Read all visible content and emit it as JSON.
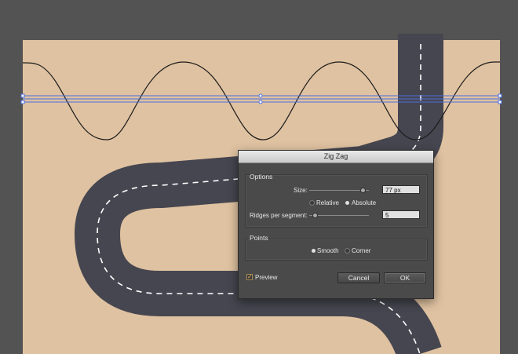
{
  "colors": {
    "workspace": "#535353",
    "artboard": "#dfc2a1",
    "road": "#464650",
    "road_markings": "#ffffff",
    "selection": "#4a6fe0",
    "dialog_bg": "#4a4a4a"
  },
  "dialog": {
    "title": "Zig Zag",
    "options": {
      "group_label": "Options",
      "size_label": "Size:",
      "size_value": "77 px",
      "relative_label": "Relative",
      "absolute_label": "Absolute",
      "mode_selected": "Absolute",
      "ridges_label": "Ridges per segment:",
      "ridges_value": "5"
    },
    "points": {
      "group_label": "Points",
      "smooth_label": "Smooth",
      "corner_label": "Corner",
      "selected": "Smooth"
    },
    "preview_label": "Preview",
    "preview_checked": true,
    "cancel_label": "Cancel",
    "ok_label": "OK"
  }
}
